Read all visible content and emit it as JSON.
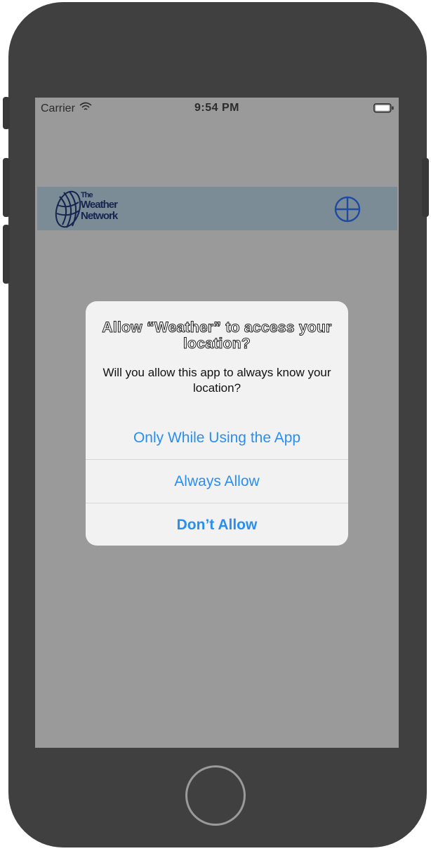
{
  "status_bar": {
    "carrier": "Carrier",
    "time": "9:54 PM",
    "wifi_icon": "wifi-icon",
    "battery_icon": "battery-icon"
  },
  "header": {
    "logo": {
      "line1": "The",
      "line2": "Weather",
      "line3": "Network"
    },
    "add_icon": "plus-circle-icon",
    "background_color": "#7c8c97",
    "accent_color": "#1f4aa0"
  },
  "alert": {
    "title": "Allow “Weather” to access your location?",
    "message": "Will you allow this app to always know your location?",
    "buttons": [
      {
        "label": "Only While Using the App"
      },
      {
        "label": "Always Allow"
      },
      {
        "label": "Don’t Allow"
      }
    ],
    "button_color": "#2a8ef0"
  }
}
